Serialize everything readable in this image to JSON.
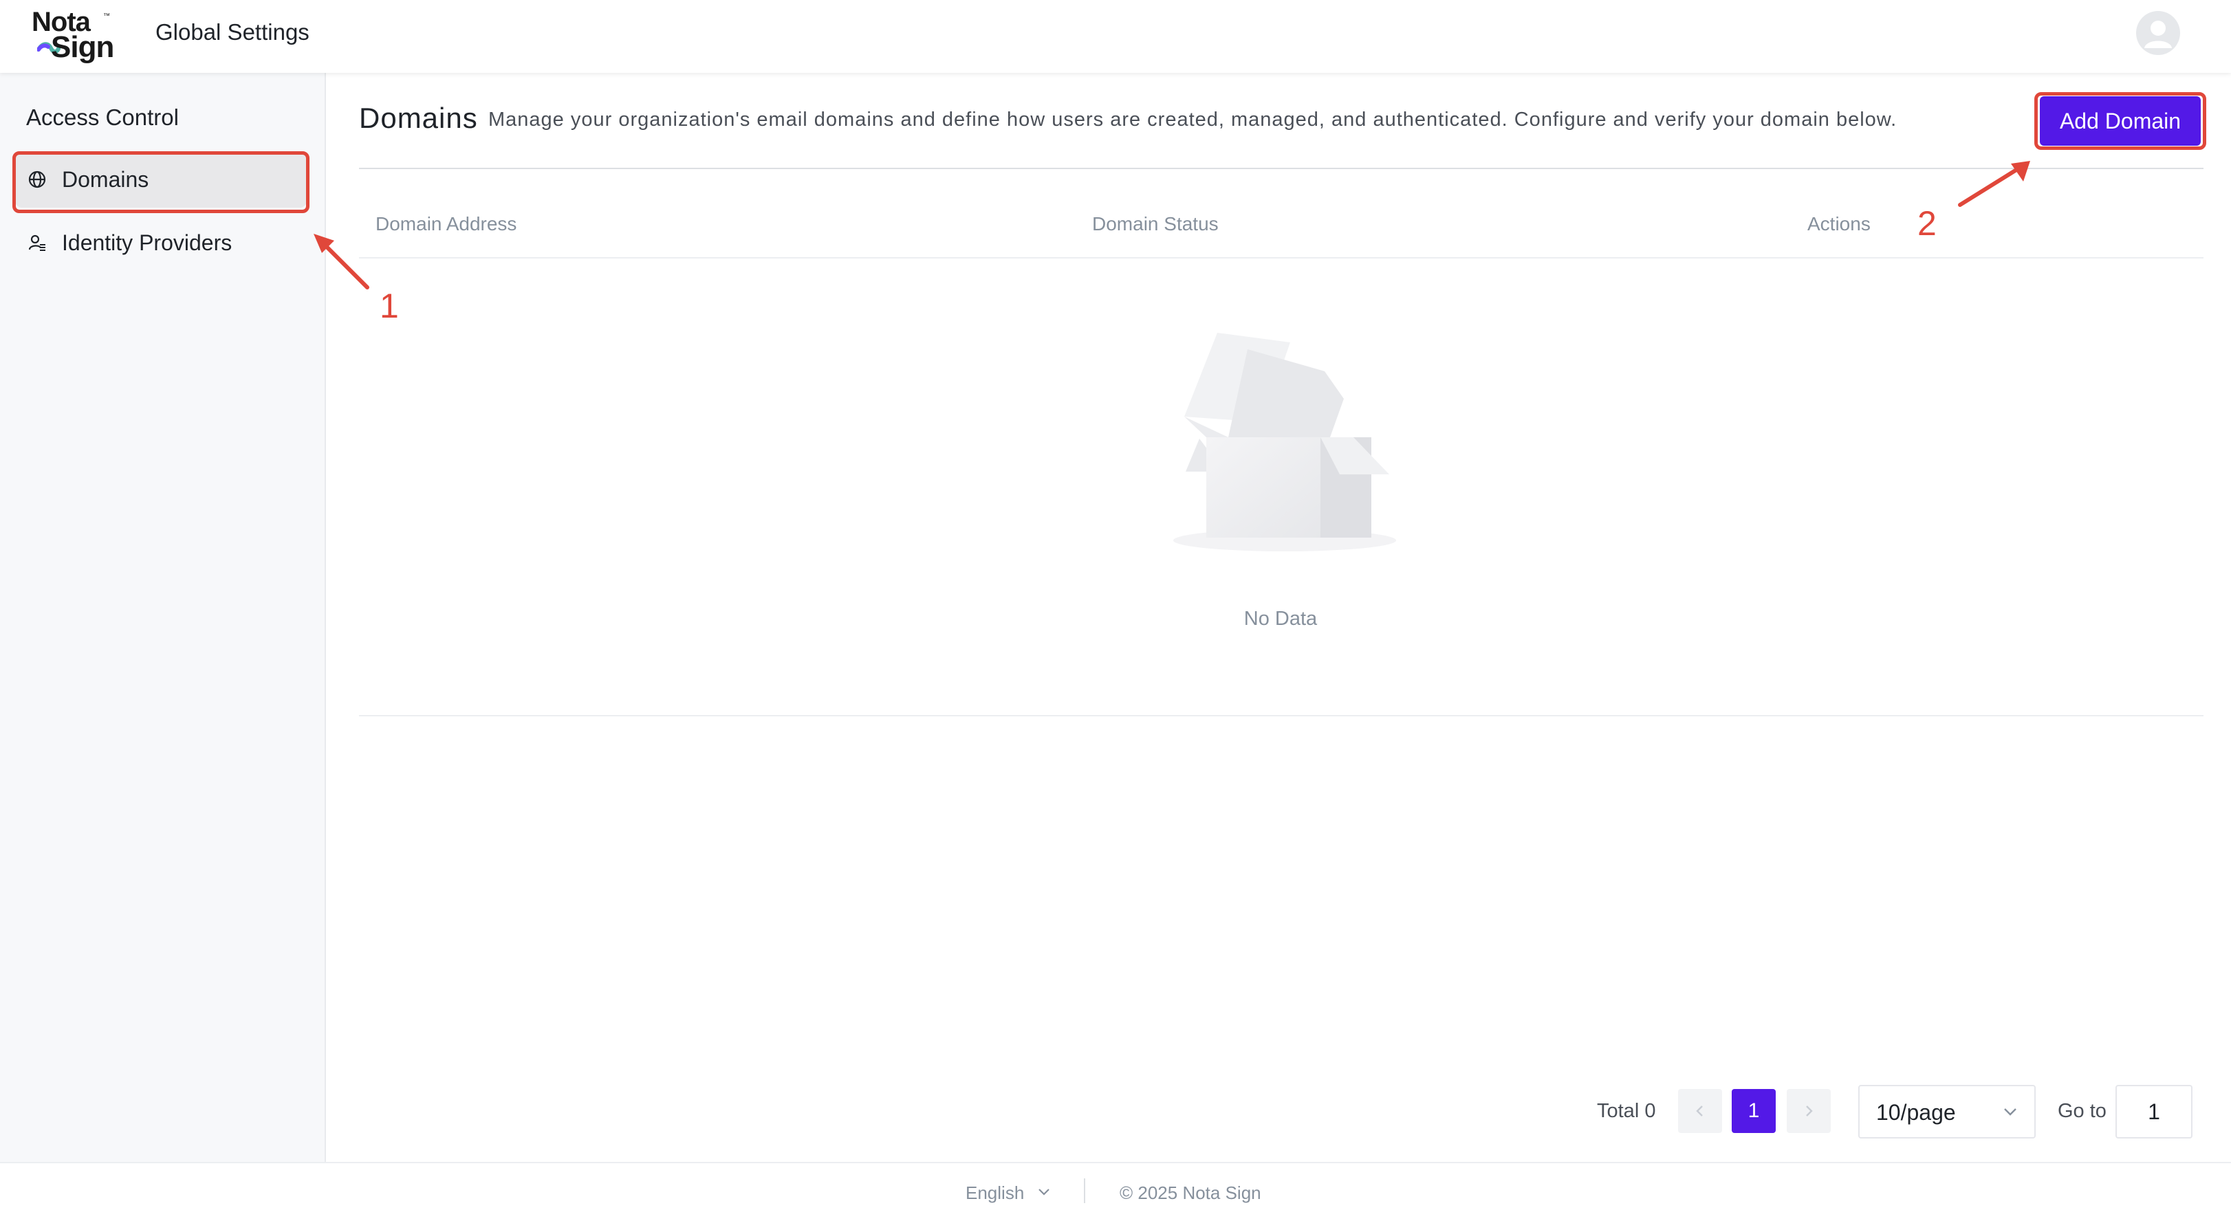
{
  "header": {
    "logo_line1": "Nota",
    "logo_line2": "Sign",
    "logo_tm": "™",
    "app_title": "Global Settings",
    "avatar_icon": "user-avatar-icon"
  },
  "sidebar": {
    "section_title": "Access Control",
    "items": [
      {
        "label": "Domains",
        "icon": "globe-icon",
        "active": true
      },
      {
        "label": "Identity Providers",
        "icon": "user-list-icon",
        "active": false
      }
    ]
  },
  "main": {
    "title": "Domains",
    "description": "Manage your organization's email domains and define how users are created, managed, and authenticated. Configure and verify your domain below.",
    "add_button": "Add Domain",
    "table": {
      "columns": [
        "Domain Address",
        "Domain Status",
        "Actions"
      ],
      "rows": [],
      "empty_text": "No Data"
    }
  },
  "annotations": {
    "marker1": "1",
    "marker2": "2",
    "color": "#e0473a"
  },
  "pagination": {
    "total_text": "Total 0",
    "current_page": "1",
    "prev_icon": "chevron-left-icon",
    "next_icon": "chevron-right-icon",
    "page_size": "10/page",
    "goto_label": "Go to",
    "goto_value": "1"
  },
  "footer": {
    "language": "English",
    "copyright": "© 2025 Nota Sign"
  },
  "colors": {
    "accent": "#5319e7",
    "sidebar_bg": "#f7f8fa",
    "highlight": "#e0473a"
  }
}
